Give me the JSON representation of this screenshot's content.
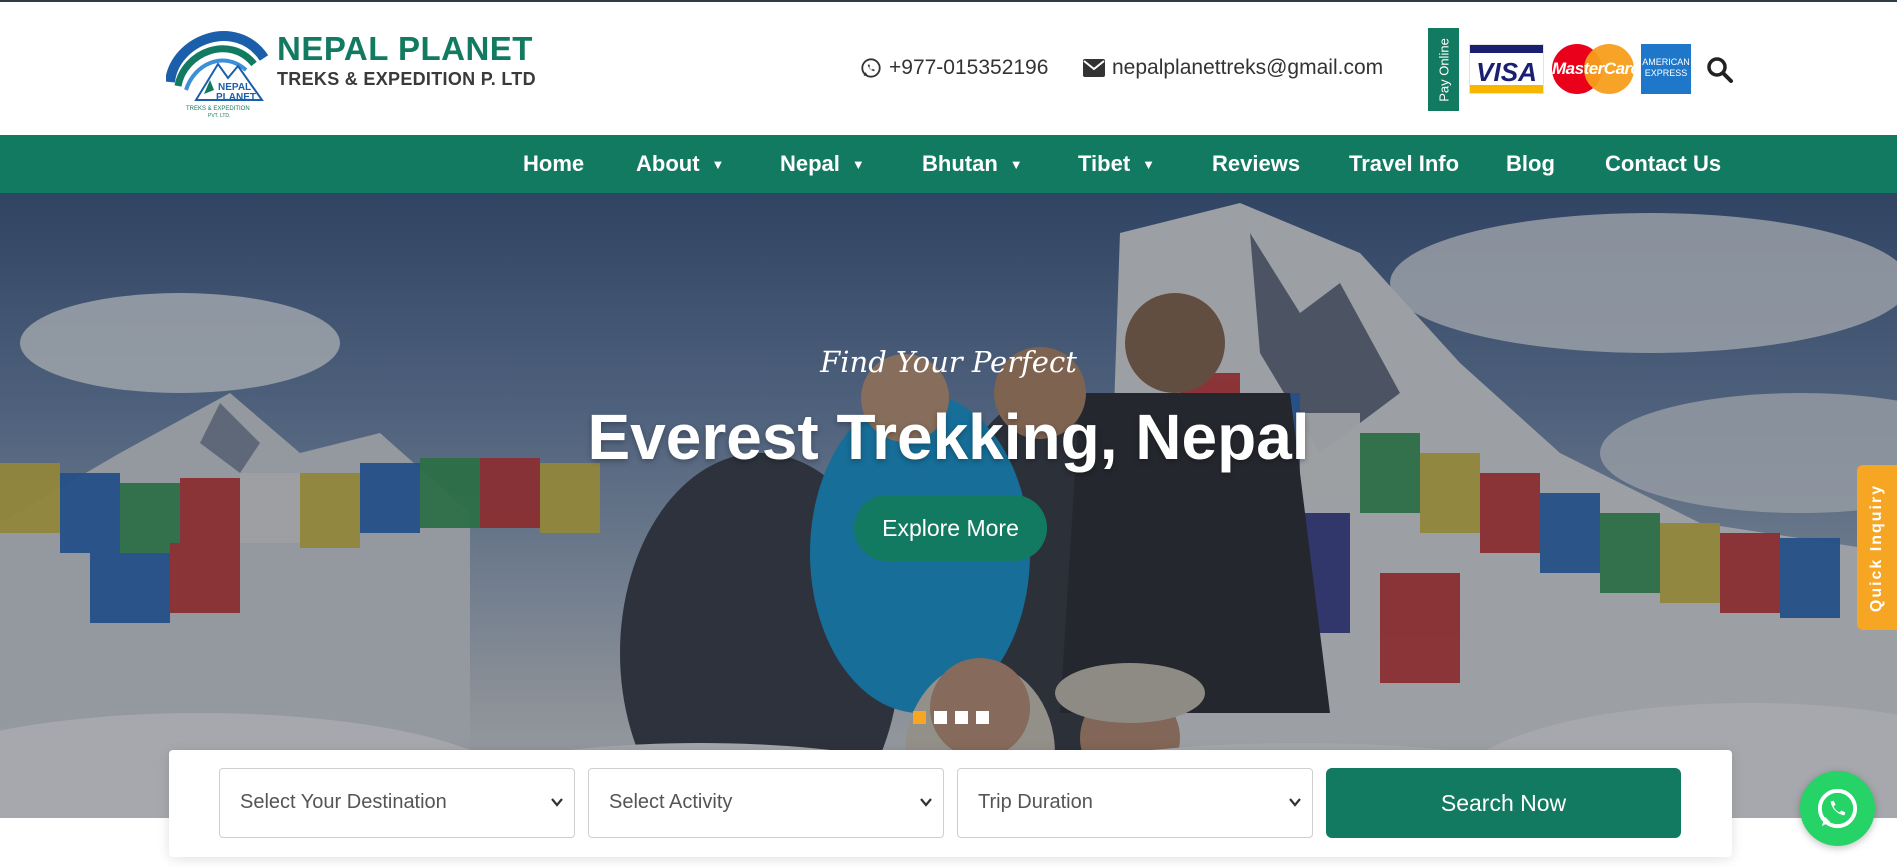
{
  "brand": {
    "name": "NEPAL PLANET",
    "subtitle": "TREKS & EXPEDITION P. LTD",
    "mark_text_1": "NEPAL",
    "mark_text_2": "PLANET",
    "mark_text_3": "TREKS & EXPEDITION",
    "mark_text_4": "PVT. LTD.",
    "colors": {
      "primary": "#137a62",
      "accent": "#f6a623",
      "logo_blue": "#1b5fab"
    }
  },
  "header": {
    "phone": {
      "icon": "whatsapp-icon",
      "text": "+977-015352196"
    },
    "email": {
      "icon": "envelope-icon",
      "text": "nepalplanettreks@gmail.com"
    },
    "pay_online": "Pay Online",
    "cards": {
      "visa": "VISA",
      "mastercard": "MasterCard",
      "amex_1": "AMERICAN",
      "amex_2": "EXPRESS"
    },
    "search_icon": "search-icon"
  },
  "nav": {
    "items": [
      {
        "label": "Home",
        "dropdown": false
      },
      {
        "label": "About",
        "dropdown": true
      },
      {
        "label": "Nepal",
        "dropdown": true
      },
      {
        "label": "Bhutan",
        "dropdown": true
      },
      {
        "label": "Tibet",
        "dropdown": true
      },
      {
        "label": "Reviews",
        "dropdown": false
      },
      {
        "label": "Travel Info",
        "dropdown": false
      },
      {
        "label": "Blog",
        "dropdown": false
      },
      {
        "label": "Contact Us",
        "dropdown": false
      }
    ],
    "chevron": "▼"
  },
  "hero": {
    "tagline": "Find Your Perfect",
    "title": "Everest Trekking, Nepal",
    "button": "Explore More",
    "slides": {
      "count": 4,
      "active": 1
    }
  },
  "quick_inquiry": "Quick Inquiry",
  "search": {
    "destination": "Select Your Destination",
    "activity": "Select Activity",
    "duration": "Trip Duration",
    "button": "Search Now"
  },
  "whatsapp_float_icon": "whatsapp-icon"
}
